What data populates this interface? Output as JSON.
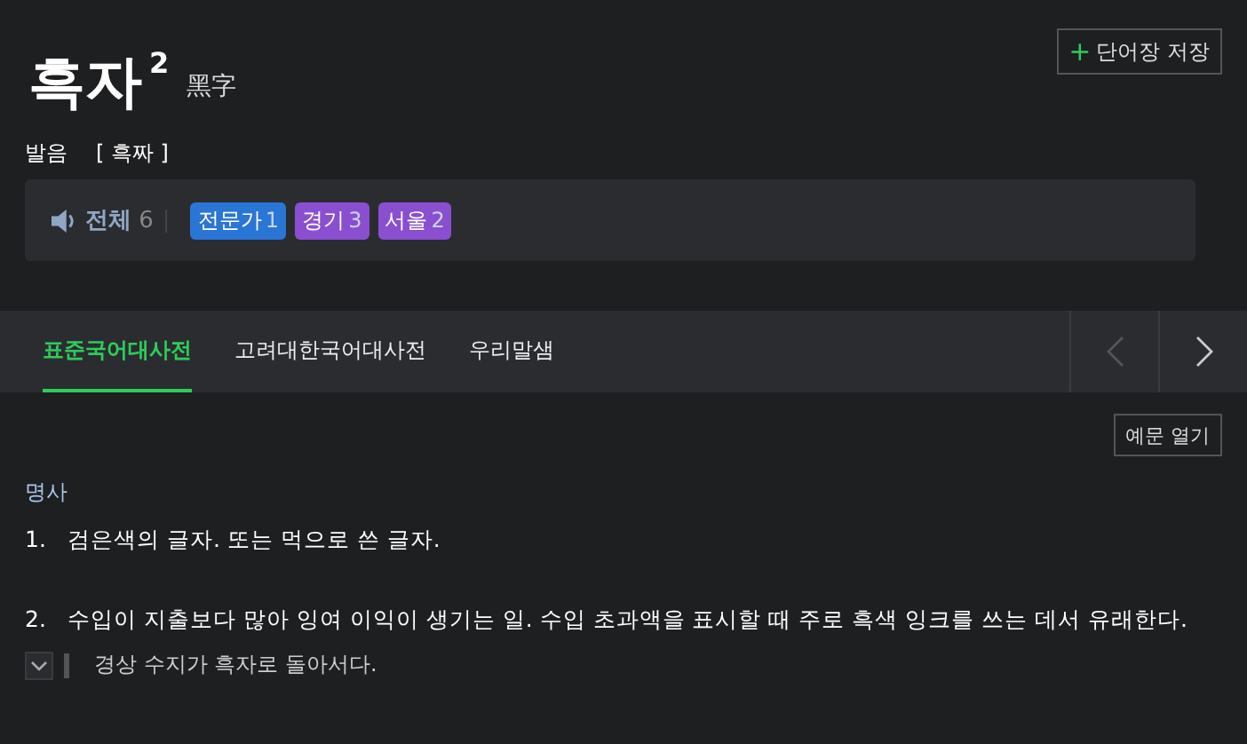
{
  "entry": {
    "word": "흑자",
    "homonym": "2",
    "hanja": "黑字"
  },
  "save_button": {
    "icon": "+",
    "label": "단어장 저장"
  },
  "pronunciation": {
    "label": "발음",
    "value": "[ 흑짜 ]"
  },
  "audio": {
    "label": "전체",
    "count": "6",
    "tags": [
      {
        "label": "전문가",
        "count": "1",
        "color": "#2a76d6"
      },
      {
        "label": "경기",
        "count": "3",
        "color": "#8a4fd0"
      },
      {
        "label": "서울",
        "count": "2",
        "color": "#8a4fd0"
      }
    ]
  },
  "tabs": [
    {
      "label": "표준국어대사전",
      "selected": true
    },
    {
      "label": "고려대한국어대사전",
      "selected": false
    },
    {
      "label": "우리말샘",
      "selected": false
    }
  ],
  "nav": {
    "prev_disabled": true,
    "next_disabled": false
  },
  "example_toggle": "예문 열기",
  "part_of_speech": "명사",
  "senses": [
    {
      "number": "1.",
      "text": "검은색의 글자. 또는 먹으로 쓴 글자."
    },
    {
      "number": "2.",
      "text": "수입이 지출보다 많아 잉여 이익이 생기는 일. 수입 초과액을 표시할 때 주로 흑색 잉크를 쓰는 데서 유래한다.",
      "examples": [
        "경상 수지가 흑자로 돌아서다."
      ]
    }
  ]
}
